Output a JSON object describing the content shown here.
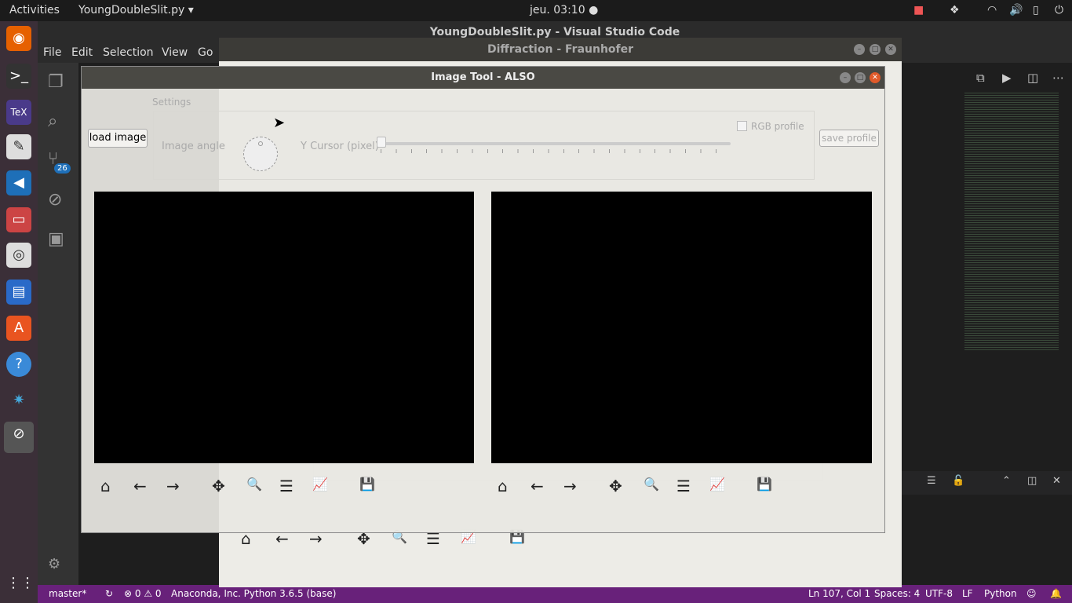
{
  "topbar": {
    "activities": "Activities",
    "app": "YoungDoubleSlit.py ▾",
    "clock": "jeu. 03:10 ●"
  },
  "dock": {
    "vscode_badge": "26"
  },
  "vscode": {
    "title": "YoungDoubleSlit.py - Visual Studio Code",
    "menu": [
      "File",
      "Edit",
      "Selection",
      "View",
      "Go"
    ],
    "status": {
      "branch": "master*",
      "errors": "0",
      "warnings": "0",
      "interpreter": "Anaconda, Inc. Python 3.6.5 (base)",
      "position": "Ln 107, Col 1",
      "spaces": "Spaces: 4",
      "encoding": "UTF-8",
      "eol": "LF",
      "language": "Python"
    }
  },
  "diffraction": {
    "title": "Diffraction - Fraunhofer"
  },
  "imagetool": {
    "title": "Image Tool - ALSO",
    "load_image": "load image",
    "settings": "Settings",
    "image_angle": "Image angle",
    "y_cursor": "Y Cursor (pixel)",
    "rgb_profile": "RGB profile",
    "save_profile": "save profile",
    "rgb_checked": false,
    "slider_value": 0
  },
  "toolbar": {
    "home": "⌂",
    "back": "←",
    "forward": "→",
    "pan": "✥",
    "zoom": "🔍",
    "configure": "☰",
    "edit": "📈",
    "save": "💾"
  }
}
